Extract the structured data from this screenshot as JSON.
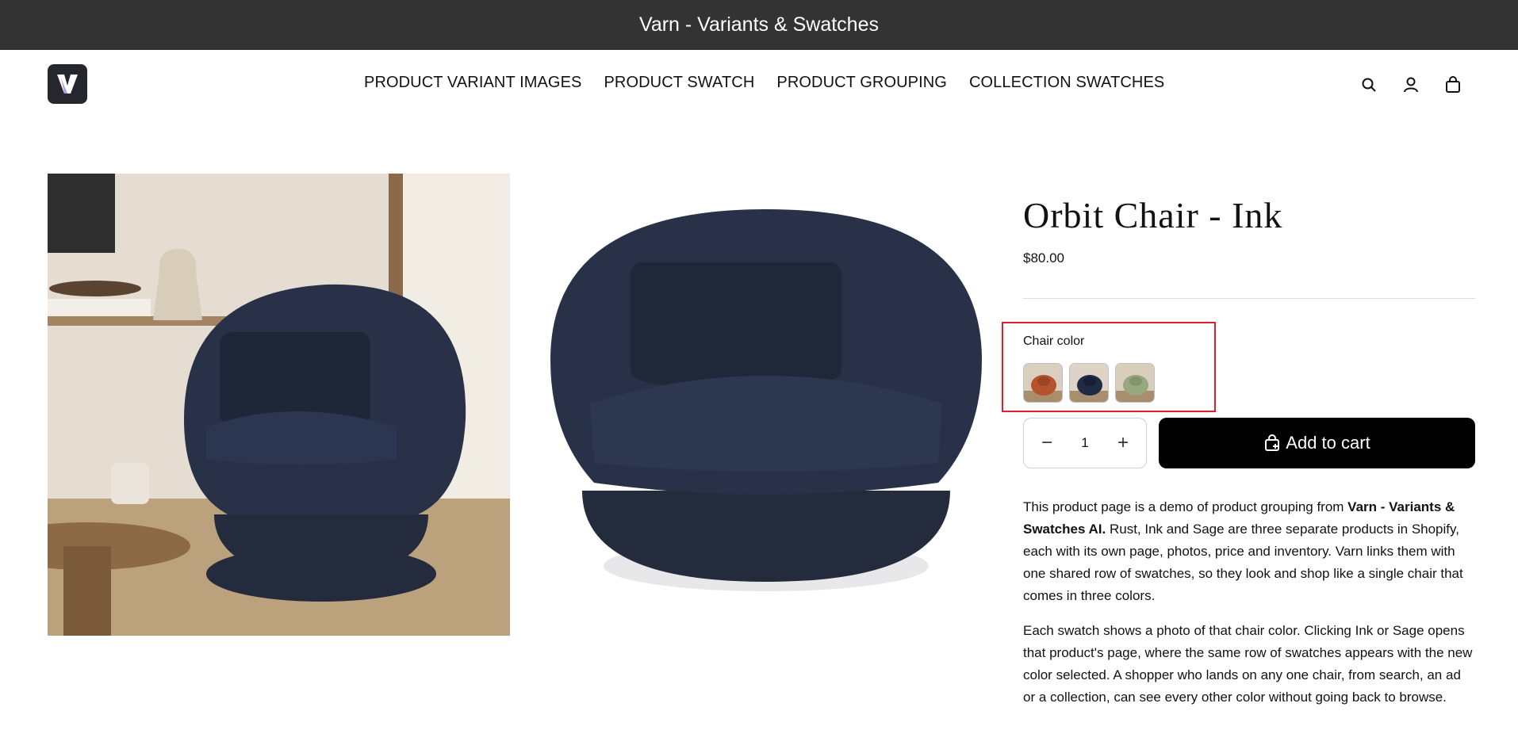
{
  "announcement": {
    "text": "Varn - Variants & Swatches"
  },
  "nav": {
    "items": [
      "PRODUCT VARIANT IMAGES",
      "PRODUCT SWATCH",
      "PRODUCT GROUPING",
      "COLLECTION SWATCHES"
    ]
  },
  "header_icons": [
    "search-icon",
    "account-icon",
    "cart-icon"
  ],
  "product": {
    "title": "Orbit Chair - Ink",
    "price": "$80.00",
    "swatch_label": "Chair color",
    "swatches": [
      {
        "name": "Rust",
        "color": "#b5532c"
      },
      {
        "name": "Ink",
        "color": "#1f2a44"
      },
      {
        "name": "Sage",
        "color": "#97a77e"
      }
    ],
    "quantity": "1",
    "add_to_cart": "Add to cart",
    "description": {
      "p1_pre": "This product page is a demo of product grouping from ",
      "p1_bold": "Varn - Variants & Swatches AI.",
      "p1_post": " Rust, Ink and Sage are three separate products in Shopify, each with its own page, photos, price and inventory. Varn links them with one shared row of swatches, so they look and shop like a single chair that comes in three colors.",
      "p2": "Each swatch shows a photo of that chair color. Clicking Ink or Sage opens that product's page, where the same row of swatches appears with the new color selected. A shopper who lands on any one chair, from search, an ad or a collection, can see every other color without going back to browse."
    }
  },
  "colors": {
    "announcement_bg": "#333333",
    "chair": "#232b3d",
    "highlight": "#e31e24"
  }
}
